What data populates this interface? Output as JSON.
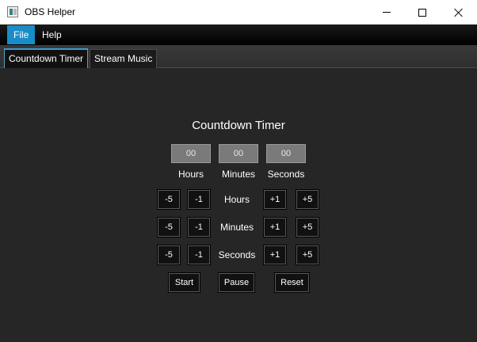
{
  "window": {
    "title": "OBS Helper"
  },
  "menu": {
    "file": "File",
    "help": "Help"
  },
  "tabs": [
    {
      "label": "Countdown Timer",
      "active": true
    },
    {
      "label": "Stream Music",
      "active": false
    }
  ],
  "timer": {
    "heading": "Countdown Timer",
    "fields": {
      "hours": "00",
      "minutes": "00",
      "seconds": "00"
    },
    "field_labels": {
      "hours": "Hours",
      "minutes": "Minutes",
      "seconds": "Seconds"
    },
    "rows": {
      "hours": {
        "label": "Hours",
        "minus5": "-5",
        "minus1": "-1",
        "plus1": "+1",
        "plus5": "+5"
      },
      "minutes": {
        "label": "Minutes",
        "minus5": "-5",
        "minus1": "-1",
        "plus1": "+1",
        "plus5": "+5"
      },
      "seconds": {
        "label": "Seconds",
        "minus5": "-5",
        "minus1": "-1",
        "plus1": "+1",
        "plus5": "+5"
      }
    },
    "controls": {
      "start": "Start",
      "pause": "Pause",
      "reset": "Reset"
    }
  },
  "colors": {
    "menu_active": "#1a8cc7",
    "panel_bg": "#262626",
    "field_bg": "#7a7a7a",
    "button_bg": "#111111"
  }
}
